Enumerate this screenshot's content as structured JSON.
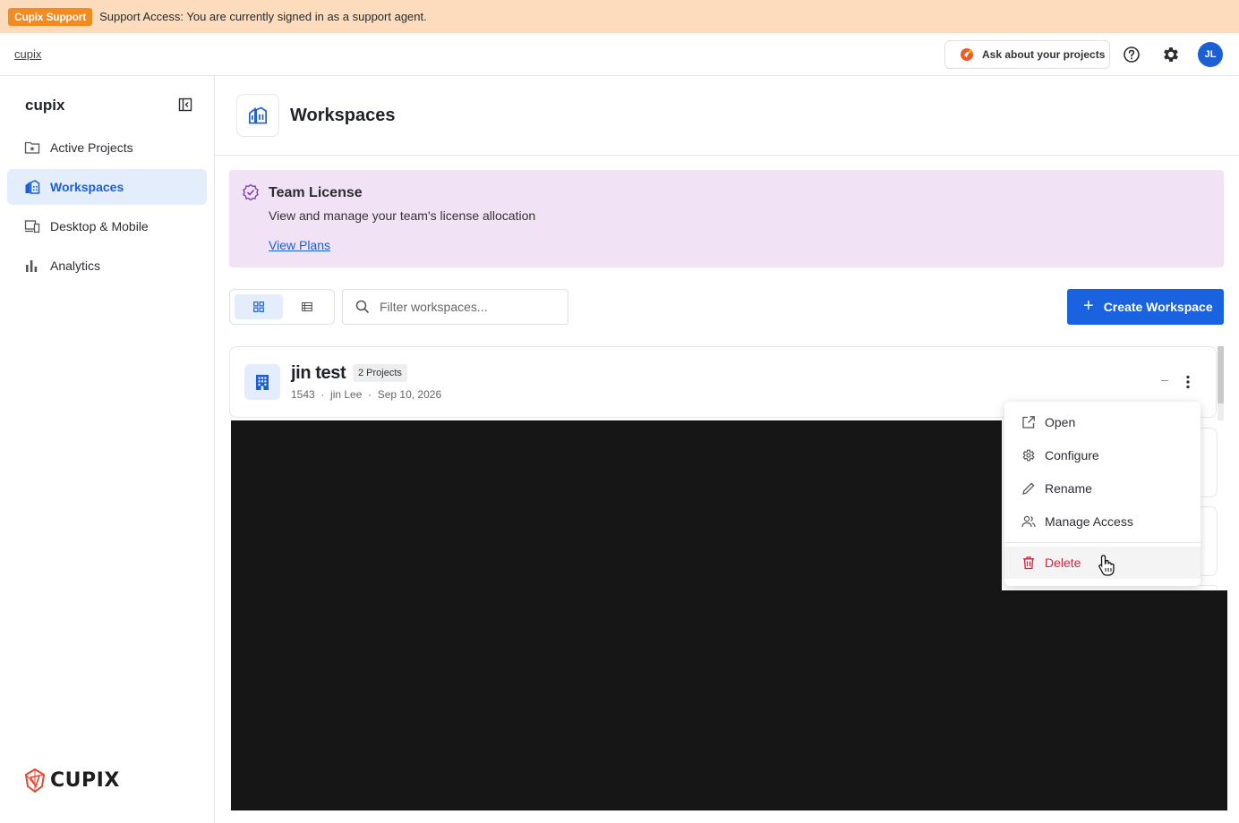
{
  "support": {
    "badge": "Cupix Support",
    "message": "Support Access: You are currently signed in as a support agent."
  },
  "topbar": {
    "brand": "cupix",
    "ask_label": "Ask about your projects",
    "avatar_initials": "JL"
  },
  "sidebar": {
    "brand": "cupix",
    "items": [
      {
        "label": "Active Projects",
        "icon": "folder-star-icon",
        "active": false
      },
      {
        "label": "Workspaces",
        "icon": "workspaces-icon",
        "active": true
      },
      {
        "label": "Desktop & Mobile",
        "icon": "devices-icon",
        "active": false
      },
      {
        "label": "Analytics",
        "icon": "bar-chart-icon",
        "active": false
      }
    ],
    "logo_text": "CUPIX"
  },
  "page": {
    "title": "Workspaces"
  },
  "license": {
    "title": "Team License",
    "description": "View and manage your team's license allocation",
    "link": "View Plans"
  },
  "toolbar": {
    "filter_placeholder": "Filter workspaces...",
    "create_label": "Create Workspace"
  },
  "workspace": {
    "name": "jin test",
    "badge": "2 Projects",
    "meta": "1543  ·  jin Lee  ·  Sep 10, 2026"
  },
  "context_menu": {
    "items": [
      "Open",
      "Configure",
      "Rename",
      "Manage Access"
    ],
    "delete_label": "Delete"
  },
  "colors": {
    "accent": "#1a62e0",
    "danger": "#e01e3c",
    "banner": "#fcdcbd",
    "license_bg": "#f1e3f5"
  }
}
